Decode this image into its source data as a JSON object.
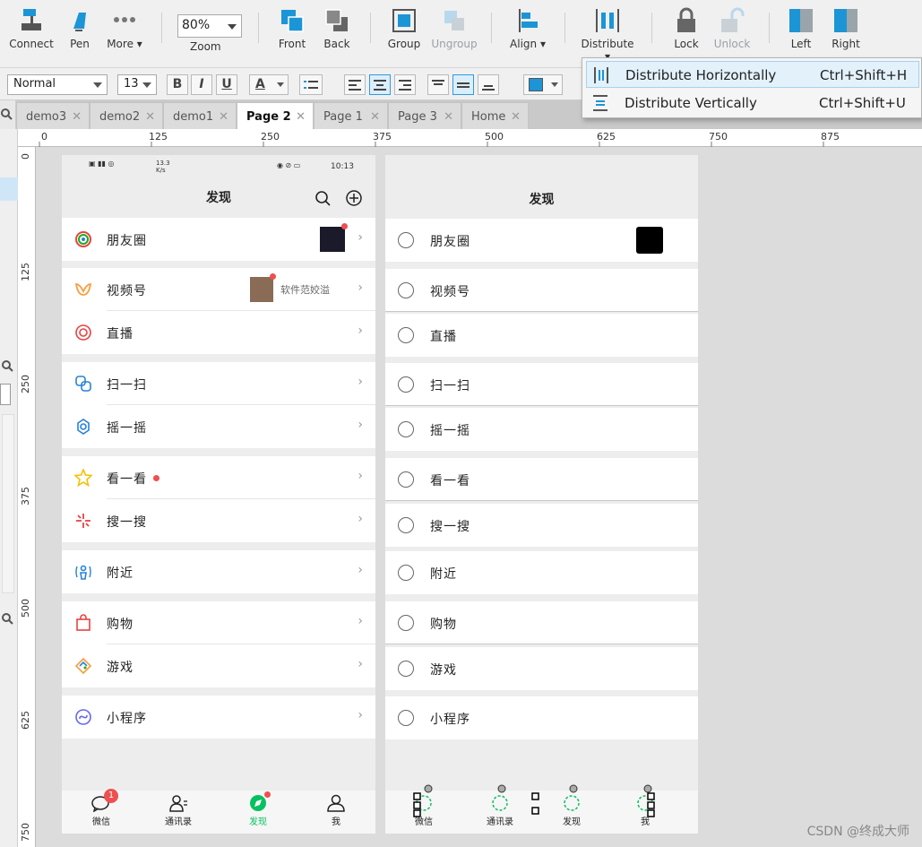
{
  "toolbar": {
    "connect": "Connect",
    "pen": "Pen",
    "more": "More ▾",
    "zoom_value": "80%",
    "zoom": "Zoom",
    "front": "Front",
    "back": "Back",
    "group": "Group",
    "ungroup": "Ungroup",
    "align": "Align ▾",
    "distribute": "Distribute ▾",
    "lock": "Lock",
    "unlock": "Unlock",
    "left": "Left",
    "right": "Right"
  },
  "formatbar": {
    "style": "Normal",
    "font_size": "13",
    "bold": "B",
    "italic": "I",
    "underline": "U",
    "font_color": "A"
  },
  "tabs": [
    {
      "label": "demo3",
      "close": "✕"
    },
    {
      "label": "demo2",
      "close": "✕"
    },
    {
      "label": "demo1",
      "close": "✕"
    },
    {
      "label": "Page 2",
      "close": "✕"
    },
    {
      "label": "Page 1",
      "close": "✕"
    },
    {
      "label": "Page 3",
      "close": "✕"
    },
    {
      "label": "Home",
      "close": "✕"
    }
  ],
  "ruler": {
    "h": [
      "0",
      "125",
      "250",
      "375",
      "500",
      "625",
      "750",
      "875"
    ],
    "v": [
      "0",
      "125",
      "250",
      "375",
      "500",
      "625",
      "750"
    ]
  },
  "menu": {
    "items": [
      {
        "label": "Distribute Horizontally",
        "shortcut": "Ctrl+Shift+H"
      },
      {
        "label": "Distribute Vertically",
        "shortcut": "Ctrl+Shift+U"
      }
    ]
  },
  "phoneA": {
    "status_left": "13.3 K/s",
    "status_right": "10:13",
    "title": "发现",
    "rows": [
      {
        "label": "朋友圈"
      },
      {
        "label": "视频号",
        "extra": "软件范姣溢"
      },
      {
        "label": "直播"
      },
      {
        "label": "扫一扫"
      },
      {
        "label": "摇一摇"
      },
      {
        "label": "看一看"
      },
      {
        "label": "搜一搜"
      },
      {
        "label": "附近"
      },
      {
        "label": "购物"
      },
      {
        "label": "游戏"
      },
      {
        "label": "小程序"
      }
    ],
    "chevron": "›",
    "tabs": [
      {
        "label": "微信",
        "badge": "1"
      },
      {
        "label": "通讯录"
      },
      {
        "label": "发现"
      },
      {
        "label": "我"
      }
    ]
  },
  "phoneB": {
    "title": "发现",
    "rows": [
      {
        "label": "朋友圈"
      },
      {
        "label": "视频号"
      },
      {
        "label": "直播"
      },
      {
        "label": "扫一扫"
      },
      {
        "label": "摇一摇"
      },
      {
        "label": "看一看"
      },
      {
        "label": "搜一搜"
      },
      {
        "label": "附近"
      },
      {
        "label": "购物"
      },
      {
        "label": "游戏"
      },
      {
        "label": "小程序"
      }
    ],
    "tabs": [
      {
        "label": "微信"
      },
      {
        "label": "通讯录"
      },
      {
        "label": "发现"
      },
      {
        "label": "我"
      }
    ]
  },
  "watermark": "CSDN @终成大师",
  "colors": {
    "accent": "#1b95d6",
    "wechat_green": "#07c160",
    "badge_red": "#f04f4f"
  }
}
